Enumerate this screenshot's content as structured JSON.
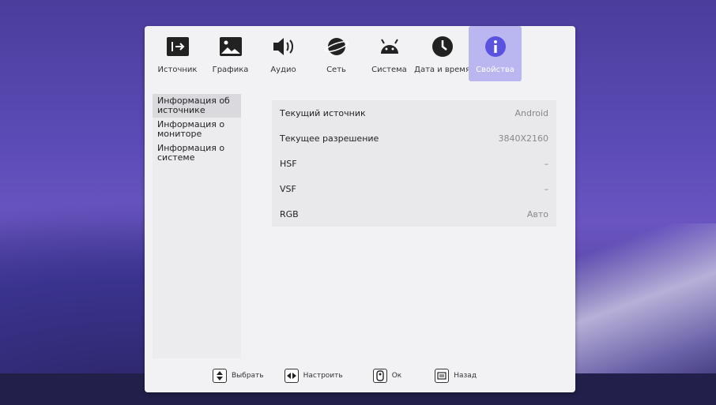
{
  "tabs": [
    {
      "label": "Источник",
      "icon": "input-source-icon"
    },
    {
      "label": "Графика",
      "icon": "picture-icon"
    },
    {
      "label": "Аудио",
      "icon": "speaker-icon"
    },
    {
      "label": "Сеть",
      "icon": "network-globe-icon"
    },
    {
      "label": "Система",
      "icon": "android-icon"
    },
    {
      "label": "Дата и время",
      "icon": "clock-icon"
    },
    {
      "label": "Свойства",
      "icon": "info-icon",
      "active": true
    }
  ],
  "sidebar": {
    "items": [
      {
        "label": "Информация об источнике",
        "selected": true
      },
      {
        "label": "Информация о мониторе"
      },
      {
        "label": "Информация о системе"
      }
    ]
  },
  "content": {
    "rows": [
      {
        "label": "Текущий источник",
        "value": "Android"
      },
      {
        "label": "Текущее разрешение",
        "value": "3840X2160"
      },
      {
        "label": "HSF",
        "value": "–"
      },
      {
        "label": "VSF",
        "value": "–"
      },
      {
        "label": "RGB",
        "value": "Авто"
      }
    ]
  },
  "footer": {
    "select_label": "Выбрать",
    "adjust_label": "Настроить",
    "ok_label": "Ок",
    "back_label": "Назад"
  },
  "colors": {
    "active_tab": "#b9b6f0",
    "accent": "#5a53e0"
  }
}
